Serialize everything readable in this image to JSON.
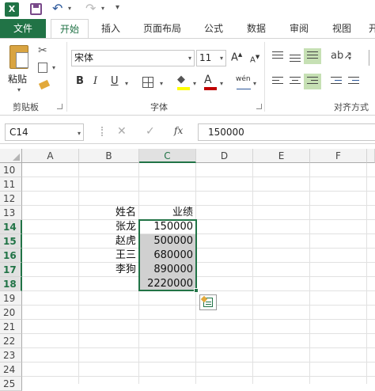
{
  "qat": {
    "app_icon": "X",
    "icons": [
      "excel-app-icon",
      "save-icon",
      "undo-icon",
      "redo-icon",
      "customize-qat-icon"
    ]
  },
  "tabs": [
    {
      "label": "文件"
    },
    {
      "label": "开始"
    },
    {
      "label": "插入"
    },
    {
      "label": "页面布局"
    },
    {
      "label": "公式"
    },
    {
      "label": "数据"
    },
    {
      "label": "审阅"
    },
    {
      "label": "视图"
    },
    {
      "label": "开"
    }
  ],
  "ribbon": {
    "clipboard": {
      "paste_label": "粘贴",
      "group_label": "剪贴板"
    },
    "font": {
      "font_name": "宋体",
      "font_size": "11",
      "grow_label": "A",
      "shrink_label": "A",
      "bold_label": "B",
      "italic_label": "I",
      "underline_label": "U",
      "font_color_label": "A",
      "phonetic_label": "wén",
      "group_label": "字体",
      "fill_color": "#ffff00",
      "font_color": "#c00000"
    },
    "alignment": {
      "group_label": "对齐方式"
    }
  },
  "formula_bar": {
    "name_box": "C14",
    "fx_label": "fx",
    "cancel_label": "✕",
    "enter_label": "✓",
    "value": "150000"
  },
  "sheet": {
    "columns": [
      "A",
      "B",
      "C",
      "D",
      "E",
      "F"
    ],
    "rows": [
      "10",
      "11",
      "12",
      "13",
      "14",
      "15",
      "16",
      "17",
      "18",
      "19",
      "20",
      "21",
      "22",
      "23",
      "24",
      "25"
    ],
    "cells": {
      "b13": "姓名",
      "c13": "业绩",
      "b14": "张龙",
      "c14": "150000",
      "b15": "赵虎",
      "c15": "500000",
      "b16": "王三",
      "c16": "680000",
      "b17": "李狗",
      "c17": "890000",
      "c18": "2220000"
    },
    "selection": "C14:C18",
    "accent": "#217346"
  }
}
